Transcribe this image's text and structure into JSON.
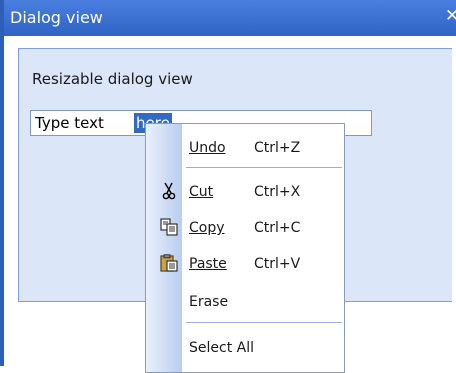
{
  "window": {
    "title": "Dialog view"
  },
  "panel": {
    "heading": "Resizable dialog view"
  },
  "textbox": {
    "typed": "Type text",
    "selected": "here"
  },
  "menu": {
    "undo": {
      "label": "Undo",
      "shortcut": "Ctrl+Z"
    },
    "cut": {
      "label": "Cut",
      "shortcut": "Ctrl+X"
    },
    "copy": {
      "label": "Copy",
      "shortcut": "Ctrl+C"
    },
    "paste": {
      "label": "Paste",
      "shortcut": "Ctrl+V"
    },
    "erase": {
      "label": "Erase"
    },
    "select_all": {
      "label": "Select All"
    }
  },
  "colors": {
    "titlebar": "#2f63c4",
    "panel": "#dbe6f9",
    "selection": "#316ac5"
  },
  "icons": [
    "scissors-icon",
    "copy-icon",
    "paste-icon"
  ]
}
